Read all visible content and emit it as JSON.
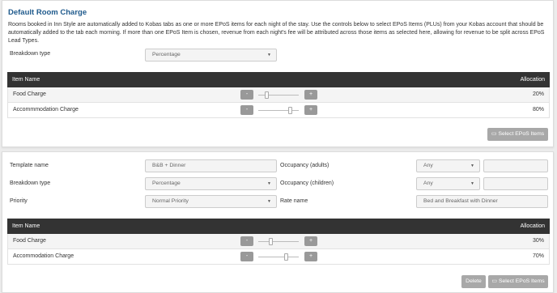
{
  "default_section": {
    "title": "Default Room Charge",
    "description": "Rooms booked in Inn Style are automatically added to Kobas tabs as one or more EPoS items for each night of the stay. Use the controls below to select EPoS Items (PLUs) from your Kobas account that should be automatically added to the tab each morning. If more than one EPoS Item is chosen, revenue from each night's fee will be attributed across those items as selected here, allowing for revenue to be split across EPoS Lead Types.",
    "breakdown_label": "Breakdown type",
    "breakdown_value": "Percentage",
    "table": {
      "col_item": "Item Name",
      "col_allocation": "Allocation",
      "rows": [
        {
          "name": "Food Charge",
          "allocation": "20%",
          "fraction": 0.2
        },
        {
          "name": "Accommmodation Charge",
          "allocation": "80%",
          "fraction": 0.8
        }
      ]
    },
    "minus": "-",
    "plus": "+",
    "select_button": "Select EPoS Items",
    "select_icon": "card-icon"
  },
  "template_section": {
    "template_name_label": "Template name",
    "template_name_value": "B&B + Dinner",
    "breakdown_label": "Breakdown type",
    "breakdown_value": "Percentage",
    "priority_label": "Priority",
    "priority_value": "Normal Priority",
    "occupancy_adults_label": "Occupancy (adults)",
    "occupancy_adults_value": "Any",
    "occupancy_children_label": "Occupancy (children)",
    "occupancy_children_value": "Any",
    "rate_name_label": "Rate name",
    "rate_name_value": "Bed and Breakfast with Dinner",
    "table": {
      "col_item": "Item Name",
      "col_allocation": "Allocation",
      "rows": [
        {
          "name": "Food Charge",
          "allocation": "30%",
          "fraction": 0.3
        },
        {
          "name": "Accommodation Charge",
          "allocation": "70%",
          "fraction": 0.7
        }
      ]
    },
    "minus": "-",
    "plus": "+",
    "delete_button": "Delete",
    "select_button": "Select EPoS Items",
    "select_icon": "card-icon"
  },
  "caret": "▼"
}
